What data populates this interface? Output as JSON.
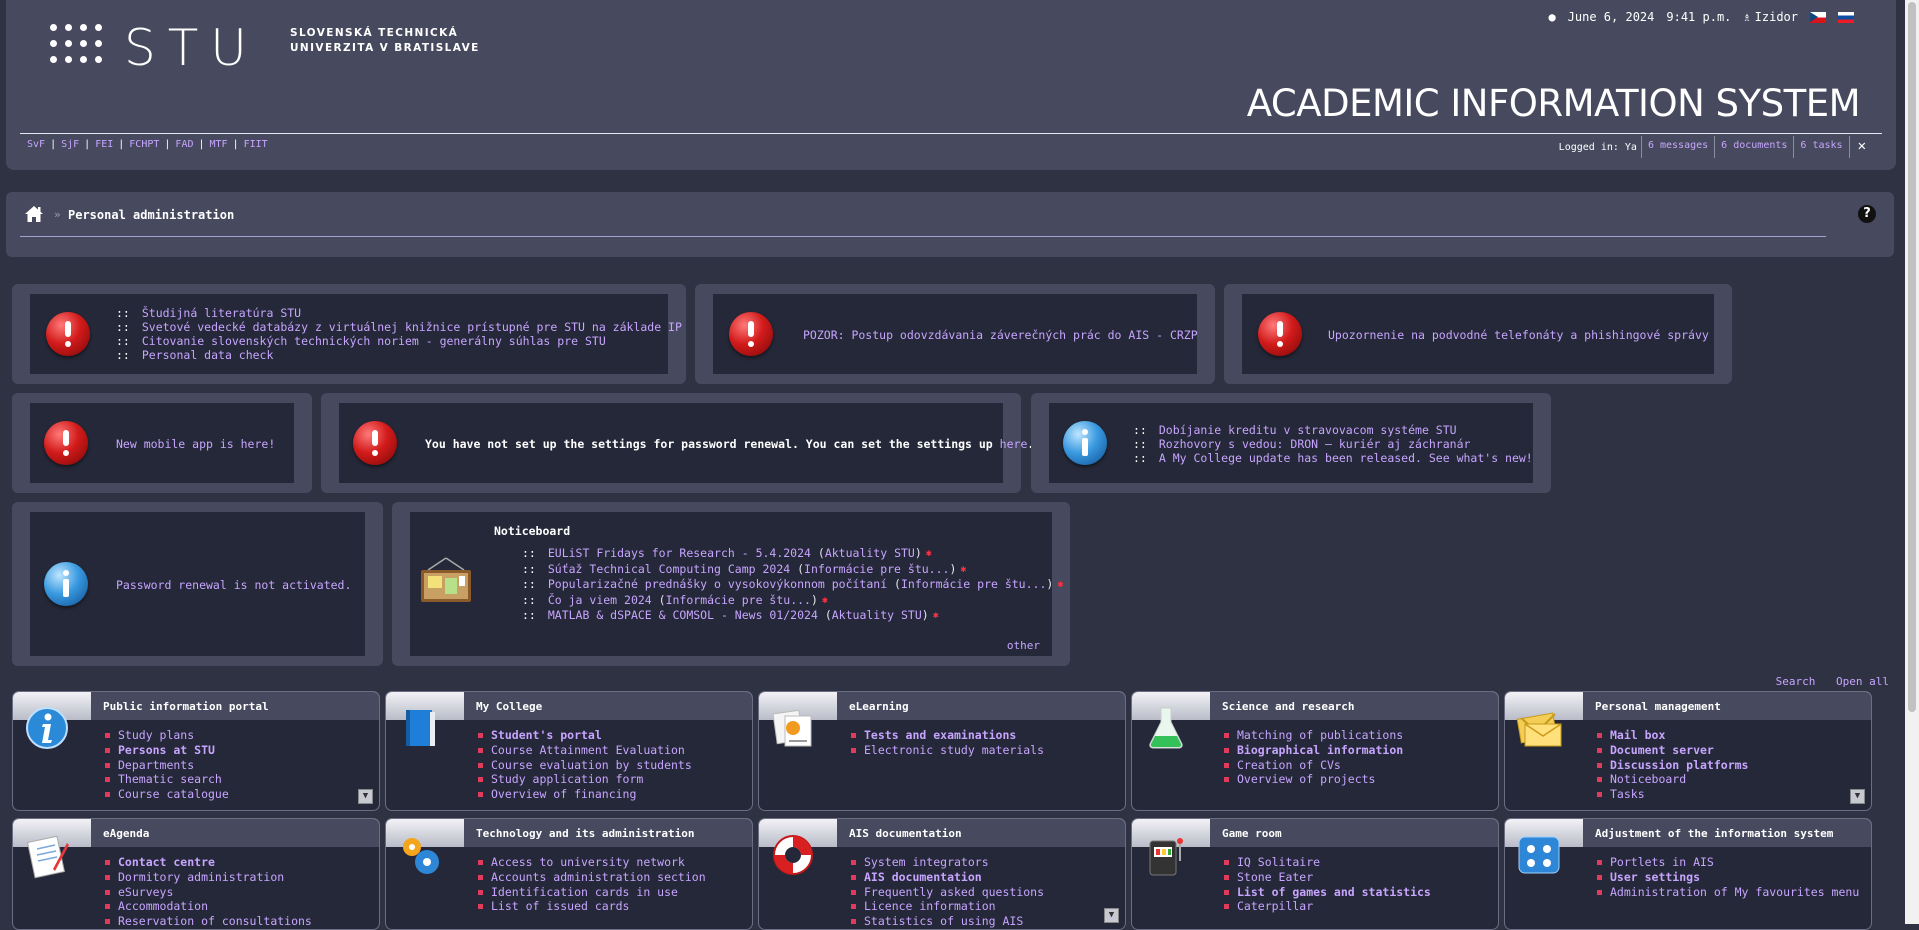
{
  "header": {
    "logo_text": "STU",
    "university_name": "SLOVENSKÁ TECHNICKÁ\nUNIVERZITA V BRATISLAVE",
    "date": "June 6, 2024",
    "time": "9:41 p.m.",
    "user": "Izidor",
    "system_title": "ACADEMIC INFORMATION SYSTEM",
    "faculties": [
      "SvF",
      "SjF",
      "FEI",
      "FCHPT",
      "FAD",
      "MTF",
      "FIIT"
    ],
    "logged_in_label": "Logged in: Ya",
    "messages": "6 messages",
    "documents": "6 documents",
    "tasks": "6 tasks",
    "close": "✕"
  },
  "breadcrumb": {
    "separator": "»",
    "title": "Personal administration",
    "help": "?"
  },
  "alerts": {
    "a1": {
      "bullet": "::",
      "items": [
        "Študijná literatúra STU",
        "Svetové vedecké databázy z virtuálnej knižnice prístupné pre STU na základe IP",
        "Citovanie slovenských technických noriem - generálny súhlas pre STU",
        "Personal data check"
      ]
    },
    "a2": "POZOR: Postup odovzdávania záverečných prác do AIS - CRZP",
    "a3": "Upozornenie na podvodné telefonáty a phishingové správy",
    "a4": "New mobile app is here!",
    "a5": {
      "text": "You have not set up the settings for password renewal. You can set the settings up ",
      "link": "here",
      "end": "."
    },
    "a6": {
      "items": [
        "Dobíjanie kreditu v stravovacom systéme STU",
        "Rozhovory s vedou: DRON – kuriér aj záchranár",
        "A My College update has been released. See what's new!"
      ]
    },
    "a7": "Password renewal is not activated."
  },
  "noticeboard": {
    "title": "Noticeboard",
    "items": [
      {
        "title": "EULiST Fridays for Research - 5.4.2024",
        "category": "Aktuality STU"
      },
      {
        "title": "Súťaž Technical Computing Camp 2024",
        "category": "Informácie pre štu..."
      },
      {
        "title": "Popularizačné prednášky o vysokovýkonnom počítaní",
        "category": "Informácie pre štu..."
      },
      {
        "title": "Čo ja viem 2024",
        "category": "Informácie pre štu..."
      },
      {
        "title": "MATLAB & dSPACE & COMSOL - News 01/2024",
        "category": "Aktuality STU"
      }
    ],
    "other": "other",
    "new_mark": "✱"
  },
  "actions": {
    "search": "Search",
    "open_all": "Open all"
  },
  "portlets": [
    {
      "title": "Public information portal",
      "icon": "info-portal-icon",
      "items": [
        "Study plans",
        "Persons at STU",
        "Departments",
        "Thematic search",
        "Course catalogue"
      ],
      "bold": [
        1
      ],
      "expand": true
    },
    {
      "title": "My College",
      "icon": "book-icon",
      "items": [
        "Student's portal",
        "Course Attainment Evaluation",
        "Course evaluation by students",
        "Study application form",
        "Overview of financing"
      ],
      "bold": [
        0
      ],
      "expand": false
    },
    {
      "title": "eLearning",
      "icon": "elearning-icon",
      "items": [
        "Tests and examinations",
        "Electronic study materials"
      ],
      "bold": [
        0
      ],
      "expand": false
    },
    {
      "title": "Science and research",
      "icon": "flask-icon",
      "items": [
        "Matching of publications",
        "Biographical information",
        "Creation of CVs",
        "Overview of projects"
      ],
      "bold": [
        1
      ],
      "expand": false
    },
    {
      "title": "Personal management",
      "icon": "envelope-icon",
      "items": [
        "Mail box",
        "Document server",
        "Discussion platforms",
        "Noticeboard",
        "Tasks"
      ],
      "bold": [
        0,
        1,
        2
      ],
      "expand": true
    },
    {
      "title": "eAgenda",
      "icon": "notepad-icon",
      "items": [
        "Contact centre",
        "Dormitory administration",
        "eSurveys",
        "Accommodation",
        "Reservation of consultations"
      ],
      "bold": [
        0
      ],
      "expand": false
    },
    {
      "title": "Technology and its administration",
      "icon": "gears-icon",
      "items": [
        "Access to university network",
        "Accounts administration section",
        "Identification cards in use",
        "List of issued cards"
      ],
      "bold": [],
      "expand": false
    },
    {
      "title": "AIS documentation",
      "icon": "lifebuoy-icon",
      "items": [
        "System integrators",
        "AIS documentation",
        "Frequently asked questions",
        "Licence information",
        "Statistics of using AIS"
      ],
      "bold": [
        1
      ],
      "expand": true
    },
    {
      "title": "Game room",
      "icon": "slot-machine-icon",
      "items": [
        "IQ Solitaire",
        "Stone Eater",
        "List of games and statistics",
        "Caterpillar"
      ],
      "bold": [
        2
      ],
      "expand": false
    },
    {
      "title": "Adjustment of the information system",
      "icon": "settings-icon",
      "items": [
        "Portlets in AIS",
        "User settings",
        "Administration of My favourites menu"
      ],
      "bold": [
        1
      ],
      "expand": false
    }
  ]
}
